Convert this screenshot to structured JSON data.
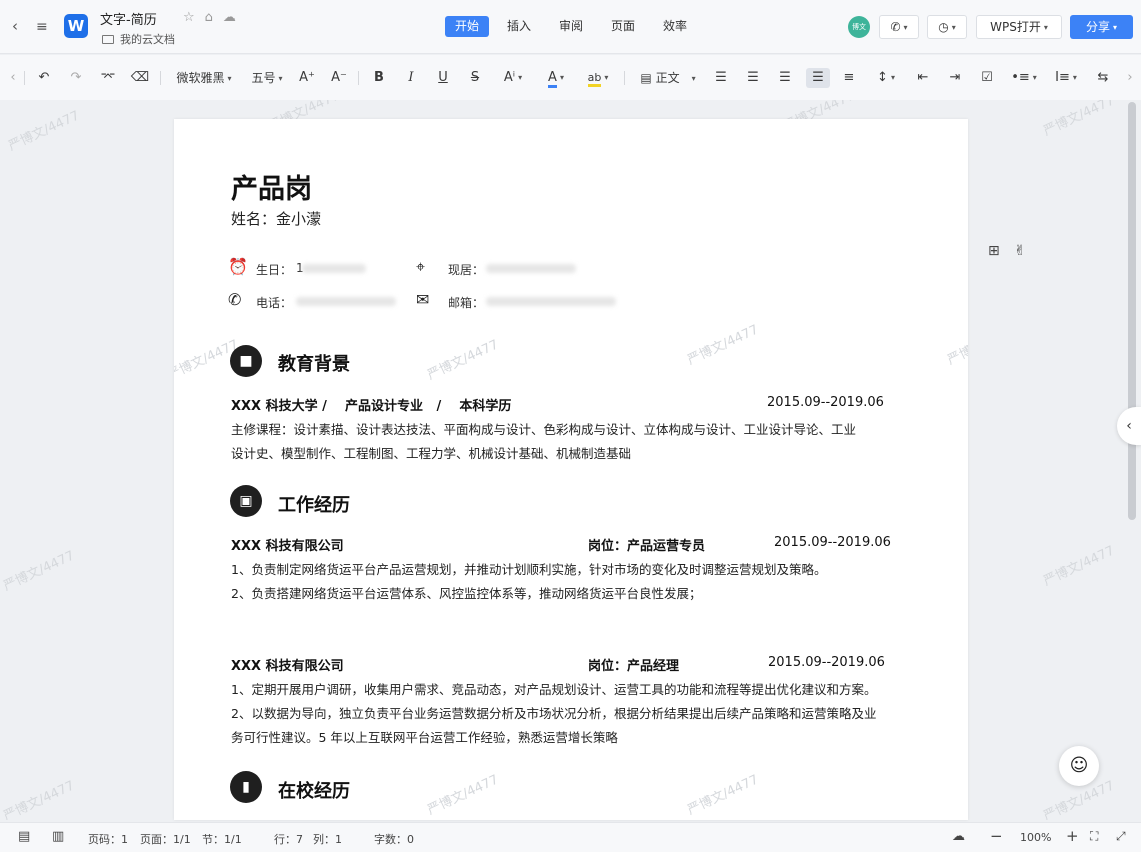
{
  "titlebar": {
    "doc_title": "文字-简历",
    "doc_path": "我的云文档",
    "tabs": [
      "开始",
      "插入",
      "审阅",
      "页面",
      "效率"
    ],
    "active_tab": "开始",
    "avatar_text": "博文",
    "wps_open_label": "WPS打开",
    "share_label": "分享"
  },
  "toolbar": {
    "font_name": "微软雅黑",
    "font_size": "五号",
    "bold": "B",
    "italic": "I",
    "underline": "U",
    "strike": "S",
    "style_label": "正文"
  },
  "watermark_text": "严博文/4477",
  "resume": {
    "title": "产品岗",
    "name_line": "姓名：金小濛",
    "birth_label": "生日：",
    "birth_value": "1",
    "address_label": "现居：",
    "phone_label": "电话：",
    "email_label": "邮箱：",
    "sections": {
      "education": {
        "title": "教育背景",
        "header": "XXX 科技大学 /    产品设计专业   /    本科学历",
        "date": "2015.09--2019.06",
        "lines": [
          "主修课程：设计素描、设计表达技法、平面构成与设计、色彩构成与设计、立体构成与设计、工业设计导论、工业",
          "设计史、模型制作、工程制图、工程力学、机械设计基础、机械制造基础"
        ]
      },
      "work": {
        "title": "工作经历",
        "jobs": [
          {
            "company": "XXX 科技有限公司",
            "position": "岗位：产品运营专员",
            "date": "2015.09--2019.06",
            "lines": [
              "1、负责制定网络货运平台产品运营规划，并推动计划顺利实施，针对市场的变化及时调整运营规划及策略。",
              "2、负责搭建网络货运平台运营体系、风控监控体系等，推动网络货运平台良性发展；"
            ]
          },
          {
            "company": "XXX 科技有限公司",
            "position": "岗位：产品经理",
            "date": "2015.09--2019.06",
            "lines": [
              "1、定期开展用户调研，收集用户需求、竞品动态，对产品规划设计、运营工具的功能和流程等提出优化建议和方案。",
              "2、以数据为导向，独立负责平台业务运营数据分析及市场状况分析，根据分析结果提出后续产品策略和运营策略及业",
              "务可行性建议。5 年以上互联网平台运营工作经验，熟悉运营增长策略"
            ]
          }
        ]
      },
      "campus": {
        "title": "在校经历"
      }
    }
  },
  "statusbar": {
    "page": "页码：1",
    "pages": "页面：1/1",
    "section": "节：1/1",
    "row": "行：7",
    "col": "列：1",
    "words": "字数：0",
    "zoom": "100%"
  },
  "colors": {
    "accent": "#3c82f6",
    "avatar": "#3eb49a",
    "logo": "#1e6fe8"
  }
}
